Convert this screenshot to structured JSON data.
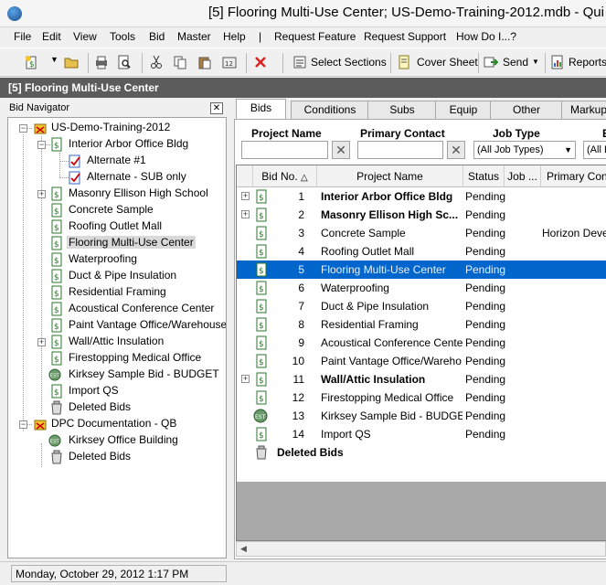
{
  "window": {
    "title": "[5] Flooring Multi-Use Center; US-Demo-Training-2012.mdb - Qui"
  },
  "menu": [
    "File",
    "Edit",
    "View",
    "Tools",
    "Bid",
    "Master",
    "Help",
    "|",
    "Request Feature",
    "Request Support",
    "How Do I...?"
  ],
  "toolbar": {
    "select_sections": "Select Sections",
    "cover_sheet": "Cover Sheet",
    "send": "Send",
    "reports": "Reports"
  },
  "header": {
    "title": "[5] Flooring Multi-Use Center"
  },
  "navigator": {
    "title": "Bid Navigator",
    "close": "✕",
    "tree": [
      {
        "label": "US-Demo-Training-2012"
      },
      {
        "label": "Interior Arbor Office Bldg"
      },
      {
        "label": "Alternate #1"
      },
      {
        "label": "Alternate - SUB only"
      },
      {
        "label": "Masonry Ellison High School"
      },
      {
        "label": "Concrete Sample"
      },
      {
        "label": "Roofing Outlet Mall"
      },
      {
        "label": "Flooring Multi-Use Center"
      },
      {
        "label": "Waterproofing"
      },
      {
        "label": "Duct & Pipe Insulation"
      },
      {
        "label": "Residential Framing"
      },
      {
        "label": "Acoustical Conference Center"
      },
      {
        "label": "Paint Vantage Office/Warehouse"
      },
      {
        "label": "Wall/Attic Insulation"
      },
      {
        "label": "Firestopping Medical Office"
      },
      {
        "label": "Kirksey Sample Bid - BUDGET"
      },
      {
        "label": "Import QS"
      },
      {
        "label": "Deleted Bids"
      },
      {
        "label": "DPC Documentation - QB"
      },
      {
        "label": "Kirksey Office Building"
      },
      {
        "label": "Deleted Bids"
      }
    ]
  },
  "tabs": [
    "Bids",
    "Conditions",
    "Subs",
    "Equip",
    "Other",
    "Markup"
  ],
  "filters": {
    "project_name": "Project Name",
    "primary_contact": "Primary Contact",
    "job_type": "Job Type",
    "job_type_value": "(All Job Types)",
    "extra_label": "E",
    "extra_value": "(All E",
    "clear": "✕"
  },
  "grid": {
    "columns": [
      "Bid No.",
      "Project Name",
      "Status",
      "Job ...",
      "Primary Conta"
    ],
    "rows": [
      {
        "no": "1",
        "name": "Interior Arbor Office Bldg",
        "status": "Pending",
        "contact": ""
      },
      {
        "no": "2",
        "name": "Masonry Ellison High Sc...",
        "status": "Pending",
        "contact": ""
      },
      {
        "no": "3",
        "name": "Concrete Sample",
        "status": "Pending",
        "contact": "Horizon Develo"
      },
      {
        "no": "4",
        "name": "Roofing Outlet Mall",
        "status": "Pending",
        "contact": ""
      },
      {
        "no": "5",
        "name": "Flooring Multi-Use Center",
        "status": "Pending",
        "contact": ""
      },
      {
        "no": "6",
        "name": "Waterproofing",
        "status": "Pending",
        "contact": ""
      },
      {
        "no": "7",
        "name": "Duct & Pipe Insulation",
        "status": "Pending",
        "contact": ""
      },
      {
        "no": "8",
        "name": "Residential Framing",
        "status": "Pending",
        "contact": ""
      },
      {
        "no": "9",
        "name": "Acoustical Conference Center",
        "status": "Pending",
        "contact": ""
      },
      {
        "no": "10",
        "name": "Paint Vantage Office/Wareho...",
        "status": "Pending",
        "contact": ""
      },
      {
        "no": "11",
        "name": "Wall/Attic Insulation",
        "status": "Pending",
        "contact": ""
      },
      {
        "no": "12",
        "name": "Firestopping Medical Office",
        "status": "Pending",
        "contact": ""
      },
      {
        "no": "13",
        "name": "Kirksey Sample Bid - BUDGET",
        "status": "Pending",
        "contact": ""
      },
      {
        "no": "14",
        "name": "Import QS",
        "status": "Pending",
        "contact": ""
      }
    ],
    "deleted_label": "Deleted Bids"
  },
  "status": {
    "datetime": "Monday, October 29, 2012 1:17 PM"
  },
  "colors": {
    "header_band": "#5c5c5c",
    "selection": "#0066cc",
    "grid_bg": "#a9a9a9"
  }
}
